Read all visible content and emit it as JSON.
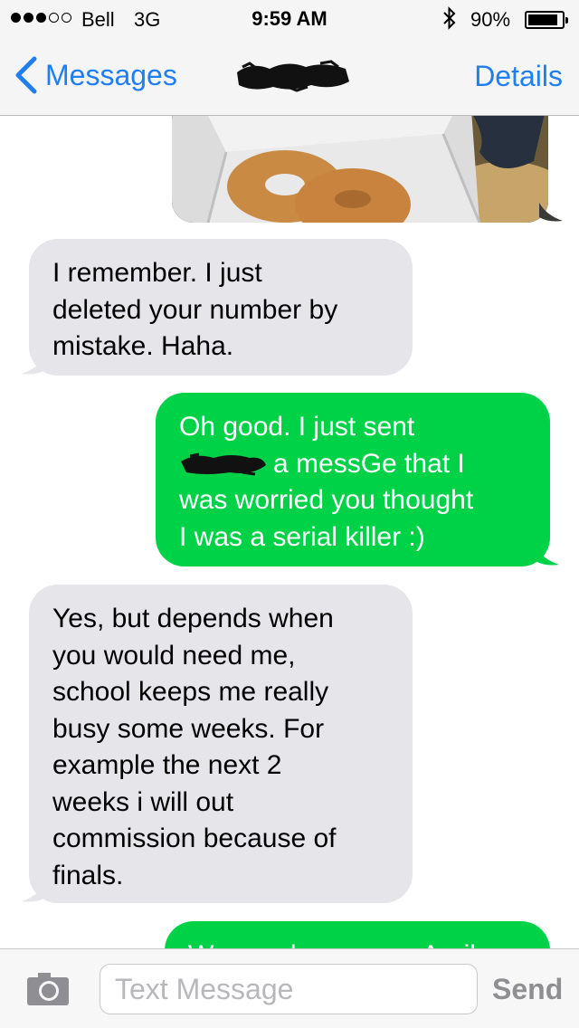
{
  "status_bar": {
    "signal_dots": 3,
    "signal_dots_total": 5,
    "carrier": "Bell",
    "network": "3G",
    "time": "9:59 AM",
    "bluetooth_icon": "bluetooth-icon",
    "battery_text": "90%",
    "battery_level": 0.9
  },
  "nav": {
    "back_label": "Messages",
    "back_icon": "chevron-left-icon",
    "details_label": "Details"
  },
  "messages": [
    {
      "direction": "outgoing",
      "type": "photo"
    },
    {
      "direction": "incoming",
      "lines": [
        "I remember. I just",
        "deleted your number by",
        "mistake. Haha."
      ]
    },
    {
      "direction": "outgoing",
      "lines": [
        "Oh good. I just sent",
        "a messGe that I",
        "was worried you thought",
        "I was a serial killer :)"
      ]
    },
    {
      "direction": "incoming",
      "lines": [
        "Yes, but depends when",
        "you would need me,",
        "school keeps me really",
        "busy some weeks. For",
        "example the next 2",
        "weeks i will out",
        "commission because of",
        "finals."
      ]
    },
    {
      "direction": "outgoing",
      "lines": [
        "We need someone April"
      ]
    }
  ],
  "input_bar": {
    "camera_icon": "camera-icon",
    "placeholder": "Text Message",
    "send_label": "Send"
  },
  "colors": {
    "accent": "#1f7ff0",
    "outgoing_bubble": "#00d248",
    "incoming_bubble": "#e5e5ea"
  }
}
